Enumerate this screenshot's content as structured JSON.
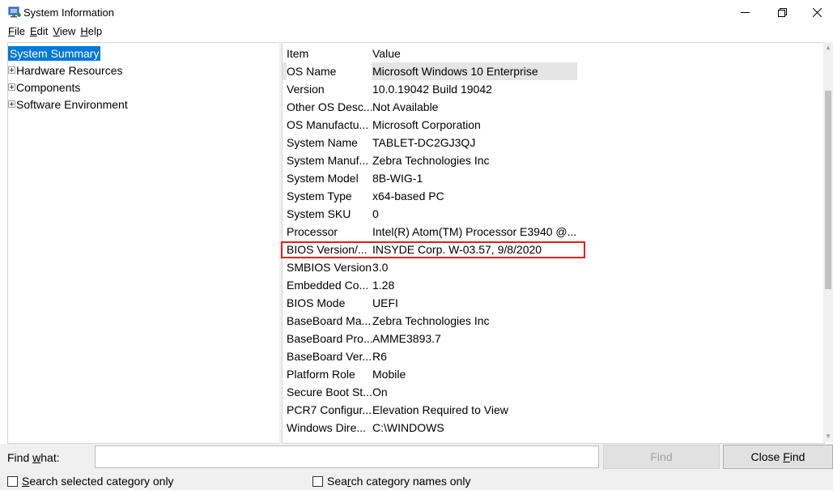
{
  "window": {
    "title": "System Information",
    "icon": "system-information-icon"
  },
  "menu": [
    {
      "label": "File",
      "accel": "F",
      "rest": "ile"
    },
    {
      "label": "Edit",
      "accel": "E",
      "rest": "dit"
    },
    {
      "label": "View",
      "accel": "V",
      "rest": "iew"
    },
    {
      "label": "Help",
      "accel": "H",
      "rest": "elp"
    }
  ],
  "tree": [
    {
      "label": "System Summary",
      "expandable": false,
      "selected": true
    },
    {
      "label": "Hardware Resources",
      "expandable": true,
      "selected": false
    },
    {
      "label": "Components",
      "expandable": true,
      "selected": false
    },
    {
      "label": "Software Environment",
      "expandable": true,
      "selected": false
    }
  ],
  "list": {
    "header": {
      "item": "Item",
      "value": "Value"
    },
    "rows": [
      {
        "item": "OS Name",
        "value": "Microsoft Windows 10 Enterprise"
      },
      {
        "item": "Version",
        "value": "10.0.19042 Build 19042"
      },
      {
        "item": "Other OS Desc...",
        "value": "Not Available"
      },
      {
        "item": "OS Manufactu...",
        "value": "Microsoft Corporation"
      },
      {
        "item": "System Name",
        "value": "TABLET-DC2GJ3QJ"
      },
      {
        "item": "System Manuf...",
        "value": "Zebra Technologies Inc"
      },
      {
        "item": "System Model",
        "value": "8B-WIG-1"
      },
      {
        "item": "System Type",
        "value": "x64-based PC"
      },
      {
        "item": "System SKU",
        "value": "0"
      },
      {
        "item": "Processor",
        "value": "Intel(R) Atom(TM) Processor E3940 @..."
      },
      {
        "item": "BIOS Version/...",
        "value": "INSYDE Corp. W-03.57, 9/8/2020"
      },
      {
        "item": "SMBIOS Version",
        "value": "3.0"
      },
      {
        "item": "Embedded Co...",
        "value": "1.28"
      },
      {
        "item": "BIOS Mode",
        "value": "UEFI"
      },
      {
        "item": "BaseBoard Ma...",
        "value": "Zebra Technologies Inc"
      },
      {
        "item": "BaseBoard Pro...",
        "value": "AMME3893.7"
      },
      {
        "item": "BaseBoard Ver...",
        "value": "R6"
      },
      {
        "item": "Platform Role",
        "value": "Mobile"
      },
      {
        "item": "Secure Boot St...",
        "value": "On"
      },
      {
        "item": "PCR7 Configur...",
        "value": "Elevation Required to View"
      },
      {
        "item": "Windows Dire...",
        "value": "C:\\WINDOWS"
      }
    ],
    "highlighted_row": "BIOS Version/..."
  },
  "find": {
    "label_accel": "w",
    "label_pre": "Find ",
    "label_post": "hat:",
    "input_value": "",
    "find_button": "Find",
    "close_find_accel": "F",
    "close_find_pre": "Close ",
    "close_find_post": "ind",
    "checkbox_selected_category": {
      "pre": "",
      "accel": "S",
      "post": "earch selected category only",
      "checked": false
    },
    "checkbox_category_names": {
      "pre": "Sea",
      "accel": "r",
      "post": "ch category names only",
      "checked": false
    }
  },
  "colors": {
    "selection": "#0078d7",
    "highlight_box": "#e0201e",
    "row_selected_bg": "#e5e5e5"
  }
}
